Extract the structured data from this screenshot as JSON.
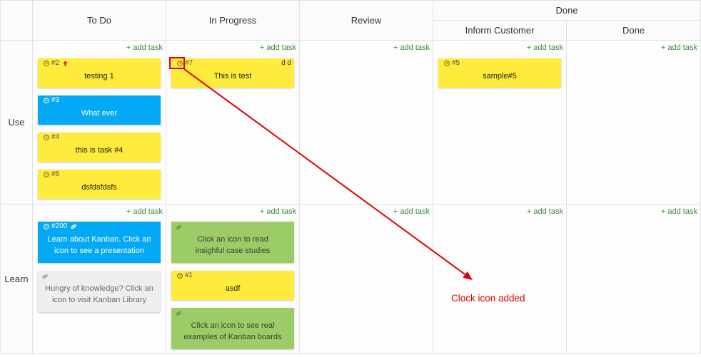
{
  "board": {
    "headers": {
      "todo": "To Do",
      "in_progress": "In Progress",
      "review": "Review",
      "done_group": "Done",
      "inform_customer": "Inform Customer",
      "done": "Done"
    },
    "add_task_label": "+ add task",
    "add_task_color": "#3a8a3a",
    "lanes": [
      {
        "label": "Use",
        "todo": [
          {
            "id": "#2",
            "title": "testing 1",
            "color": "#ffeb3b",
            "icons": [
              "clock-icon",
              "priority-up-icon"
            ]
          },
          {
            "id": "#3",
            "title": "What ever",
            "color": "#03a9f4",
            "icons": [
              "clock-icon"
            ]
          },
          {
            "id": "#4",
            "title": "this is task #4",
            "color": "#ffeb3b",
            "icons": [
              "clock-icon"
            ]
          },
          {
            "id": "#6",
            "title": "dsfdsfdsfs",
            "color": "#ffeb3b",
            "icons": [
              "clock-icon"
            ]
          }
        ],
        "in_progress": [
          {
            "id": "#7",
            "title": "This is test",
            "assignee": "d d",
            "color": "#ffeb3b",
            "icons": [
              "clock-icon"
            ]
          }
        ],
        "inform_customer": [
          {
            "id": "#5",
            "title": "sample#5",
            "color": "#ffeb3b",
            "icons": [
              "clock-icon"
            ]
          }
        ]
      },
      {
        "label": "Learn",
        "todo": [
          {
            "id": "#200",
            "title": "Learn about Kanban. Click an\nicon to see a presentation",
            "color": "#03a9f4",
            "icons": [
              "clock-icon",
              "link-icon"
            ]
          },
          {
            "title": "Hungry of knowledge? Click an\nicon to visit Kanban Library",
            "color": "#eeeeee",
            "icons": [
              "link-icon"
            ]
          }
        ],
        "in_progress": [
          {
            "title": "Click an icon to read\ninsighful case studies",
            "color": "#9ccc65",
            "icons": [
              "link-icon"
            ]
          },
          {
            "id": "#1",
            "title": "asdf",
            "color": "#ffeb3b",
            "icons": [
              "clock-icon"
            ]
          },
          {
            "title": "Click an icon to see real\nexamples of Kanban boards",
            "color": "#9ccc65",
            "icons": [
              "link-icon"
            ]
          }
        ]
      }
    ]
  },
  "annotation": {
    "text": "Clock icon added",
    "color": "#e00000"
  }
}
